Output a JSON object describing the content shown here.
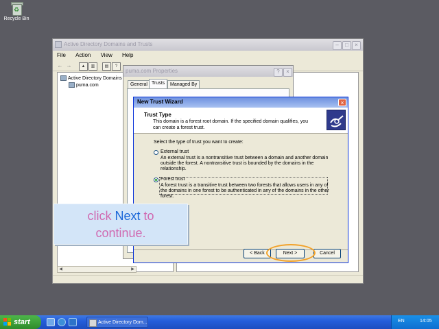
{
  "desktop": {
    "recycle_bin_label": "Recycle Bin"
  },
  "main_window": {
    "title": "Active Directory Domains and Trusts",
    "menu": [
      "File",
      "Action",
      "View",
      "Help"
    ],
    "tree": {
      "root": "Active Directory Domains an",
      "child": "puma.com"
    }
  },
  "properties_window": {
    "title": "puma.com Properties",
    "tabs": [
      "General",
      "Trusts",
      "Managed By"
    ],
    "active_tab": "Trusts"
  },
  "wizard": {
    "title": "New Trust Wizard",
    "heading": "Trust Type",
    "subheading": "This domain is a forest root domain. If the specified domain qualifies, you can create a forest trust.",
    "prompt": "Select the type of trust you want to create:",
    "options": [
      {
        "label": "External trust",
        "description": "An external trust is a nontransitive trust between a domain and another domain outside the forest. A nontransitive trust is bounded by the domains in the relationship.",
        "selected": false
      },
      {
        "label": "Forest trust",
        "description": "A forest trust is a transitive trust between two forests that allows users in any of the domains in one forest to be authenticated in any of the domains in the other forest.",
        "selected": true
      }
    ],
    "buttons": {
      "back": "< Back",
      "next": "Next >",
      "cancel": "Cancel"
    }
  },
  "callout": {
    "prefix": "click ",
    "highlight": "Next",
    "suffix": " to",
    "line2": "continue."
  },
  "taskbar": {
    "start_label": "start",
    "task_button": "Active Directory Dom...",
    "language": "EN",
    "clock": "14:05"
  },
  "colors": {
    "highlight_ring": "#f2a22a",
    "callout_bg": "#d3e5f8",
    "callout_text": "#d06ab1",
    "callout_accent": "#1b67d8"
  }
}
